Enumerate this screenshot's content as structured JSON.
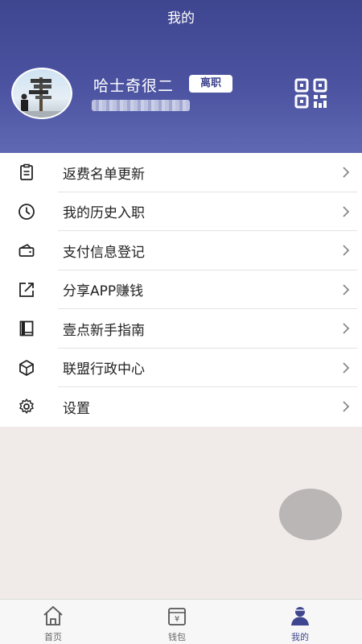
{
  "header": {
    "title": "我的"
  },
  "profile": {
    "username": "哈士奇很二",
    "status_badge": "离职"
  },
  "menu": [
    {
      "label": "返费名单更新",
      "icon": "clipboard-icon"
    },
    {
      "label": "我的历史入职",
      "icon": "clock-icon"
    },
    {
      "label": "支付信息登记",
      "icon": "wallet-icon"
    },
    {
      "label": "分享APP赚钱",
      "icon": "share-icon"
    },
    {
      "label": "壹点新手指南",
      "icon": "book-icon"
    },
    {
      "label": "联盟行政中心",
      "icon": "cube-icon"
    },
    {
      "label": "设置",
      "icon": "gear-icon"
    }
  ],
  "tabbar": [
    {
      "label": "首页",
      "icon": "home-icon",
      "active": false
    },
    {
      "label": "钱包",
      "icon": "wallet-yen-icon",
      "active": false
    },
    {
      "label": "我的",
      "icon": "user-icon",
      "active": true
    }
  ],
  "colors": {
    "accent": "#3f4690",
    "header_bottom": "#5f69b3",
    "background": "#f0ebe9"
  }
}
